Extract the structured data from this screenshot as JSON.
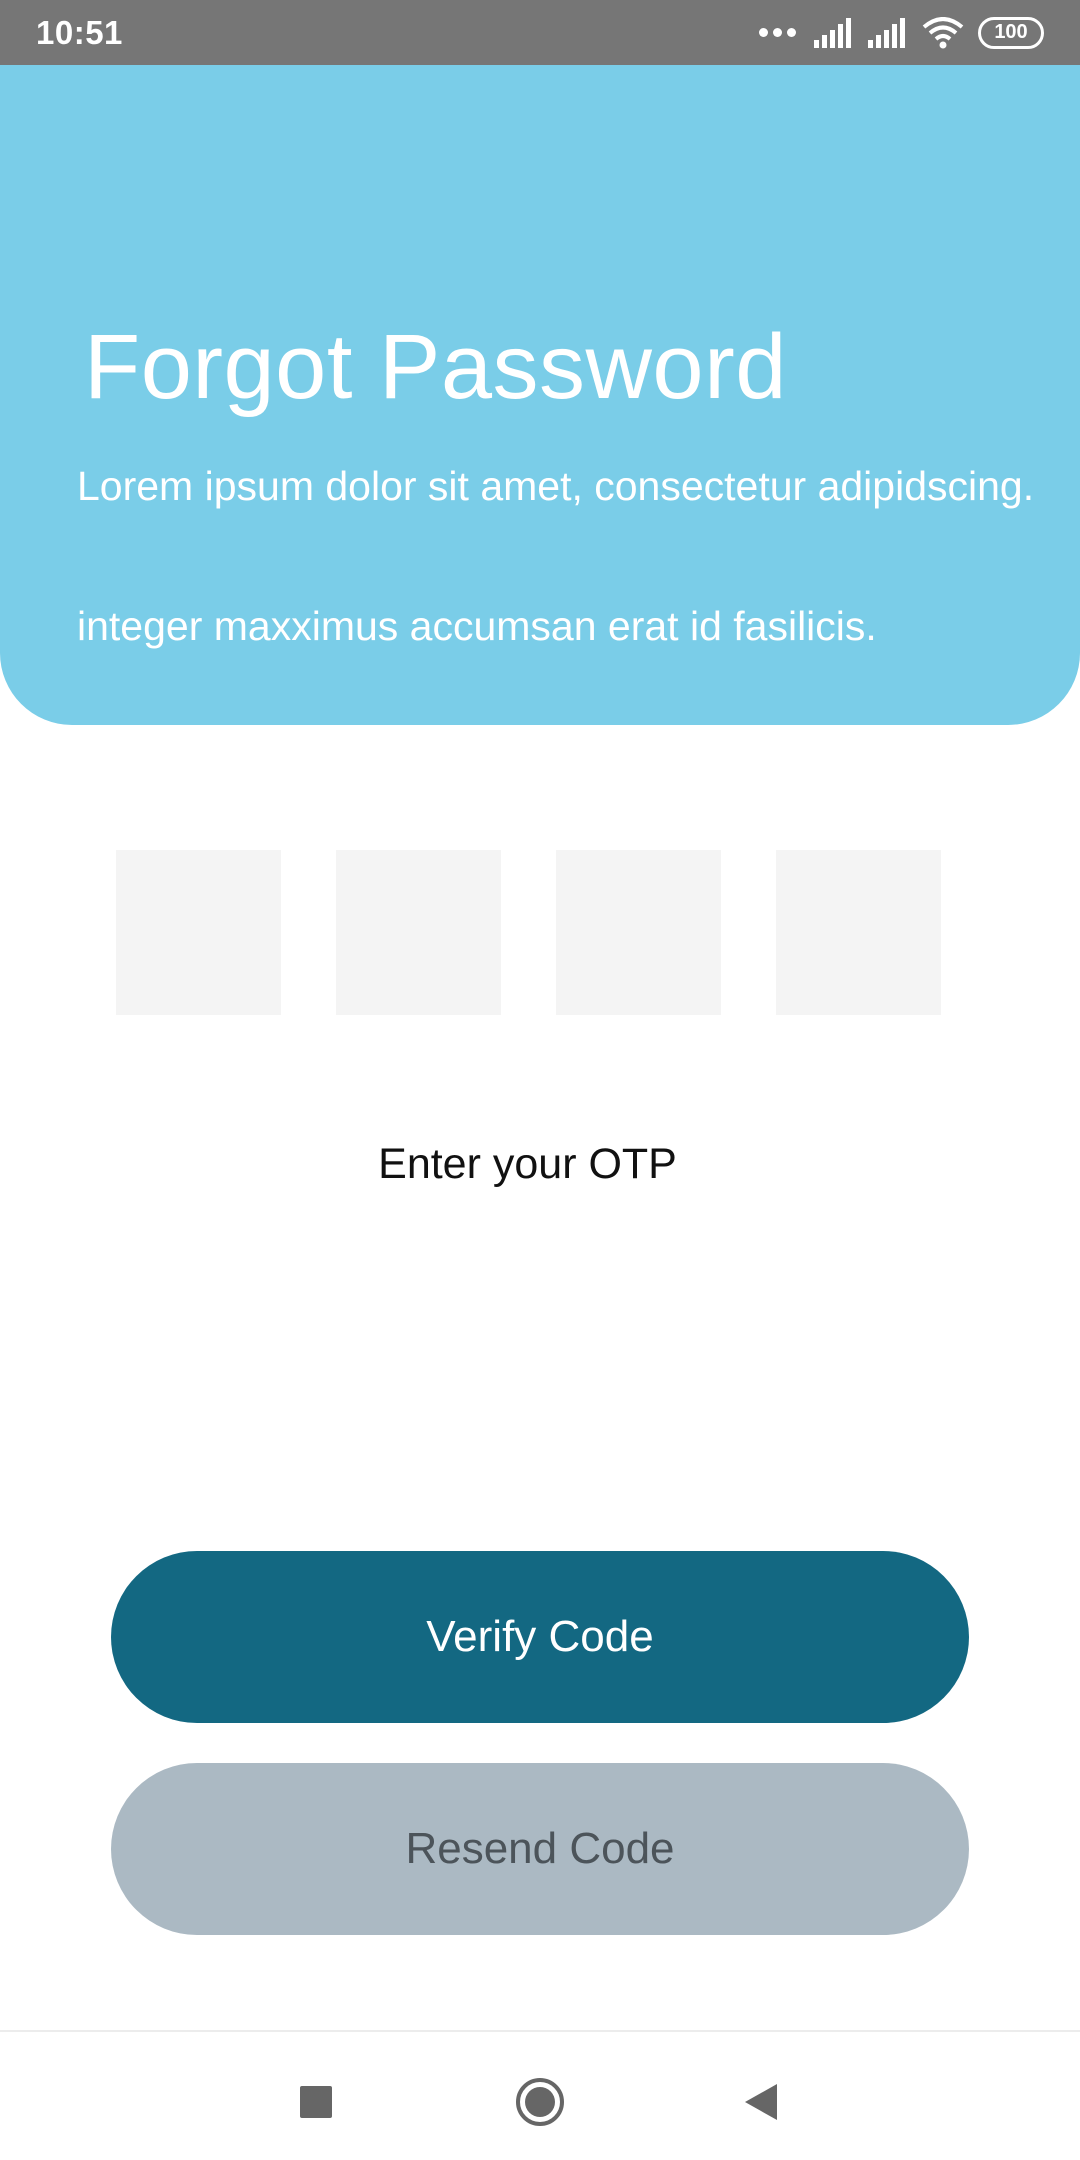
{
  "status_bar": {
    "time": "10:51",
    "battery": "100",
    "icons": [
      "more-dots-icon",
      "signal-icon",
      "signal-icon",
      "wifi-icon",
      "battery-icon"
    ]
  },
  "header": {
    "title": "Forgot Password",
    "description": "Lorem ipsum dolor sit amet, consectetur adipidscing.",
    "description2": "integer maxximus accumsan erat id fasilicis."
  },
  "otp": {
    "digits": [
      "",
      "",
      "",
      ""
    ],
    "label": "Enter your OTP"
  },
  "buttons": {
    "verify_label": "Verify Code",
    "resend_label": "Resend Code"
  },
  "nav": {
    "icons": [
      "recent-apps-icon",
      "home-icon",
      "back-icon"
    ]
  },
  "colors": {
    "header_bg": "#7acde8",
    "verify_bg": "#136882",
    "resend_bg": "#abb9c3",
    "status_bar_bg": "#767676",
    "otp_box_bg": "#f4f4f4"
  }
}
